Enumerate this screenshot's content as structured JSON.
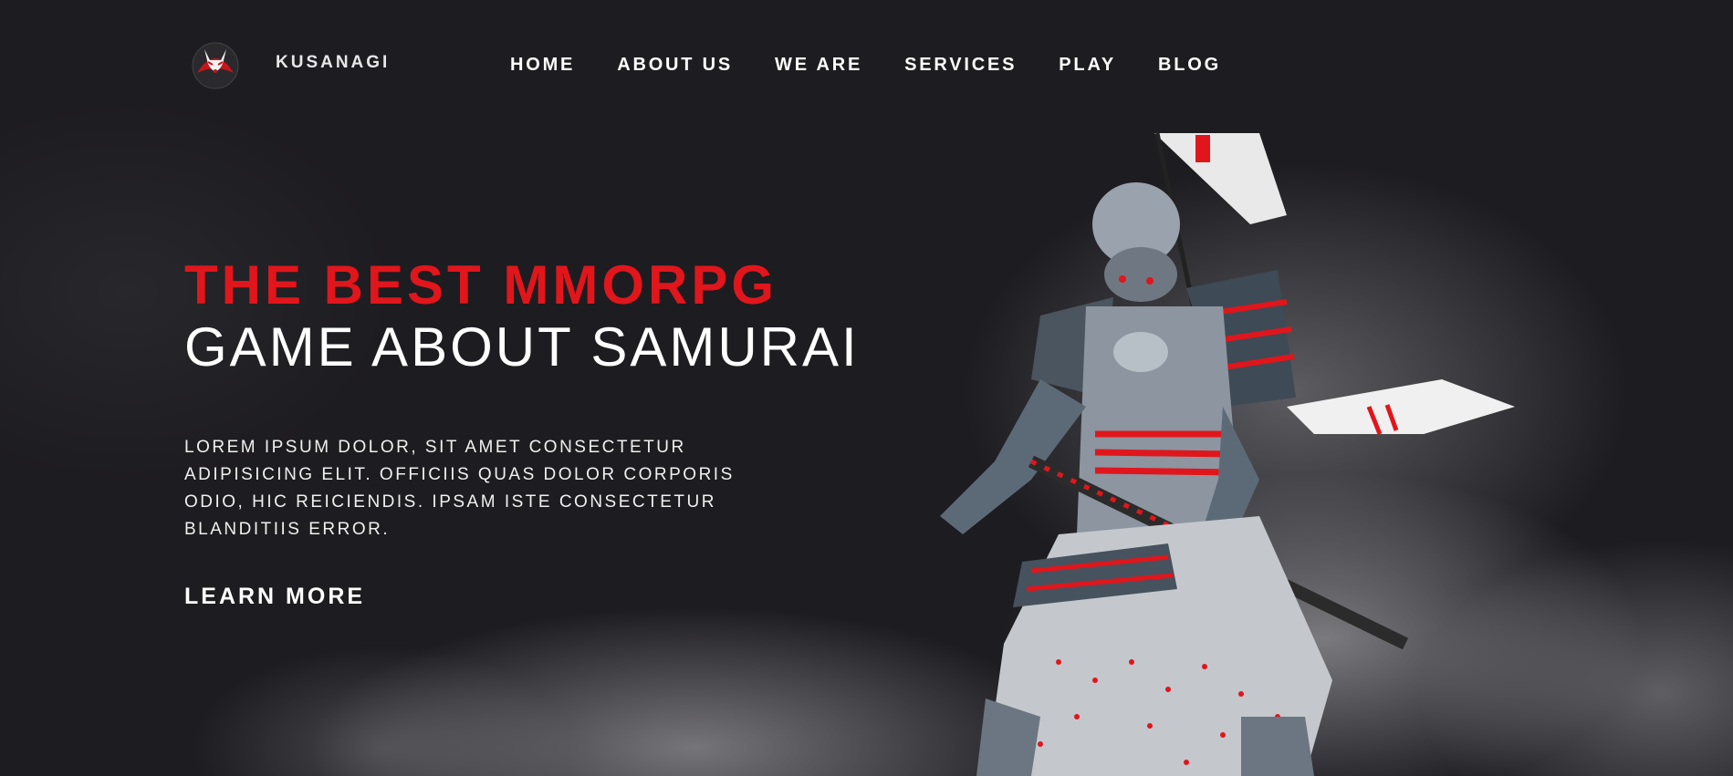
{
  "header": {
    "brand": "KUSANAGI",
    "nav": [
      "HOME",
      "ABOUT US",
      "WE ARE",
      "SERVICES",
      "PLAY",
      "BLOG"
    ]
  },
  "hero": {
    "title_line1": "THE BEST MMORPG",
    "title_line2": "GAME ABOUT SAMURAI",
    "description": "LOREM IPSUM DOLOR, SIT AMET CONSECTETUR ADIPISICING ELIT. OFFICIIS QUAS DOLOR CORPORIS ODIO, HIC REICIENDIS. IPSAM ISTE CONSECTETUR BLANDITIIS ERROR.",
    "cta": "LEARN MORE"
  },
  "colors": {
    "background": "#1d1c20",
    "accent": "#e0161c",
    "text": "#ffffff"
  },
  "icons": {
    "logo": "kitsune-mask-logo",
    "hero_image": "samurai-warrior-illustration"
  }
}
